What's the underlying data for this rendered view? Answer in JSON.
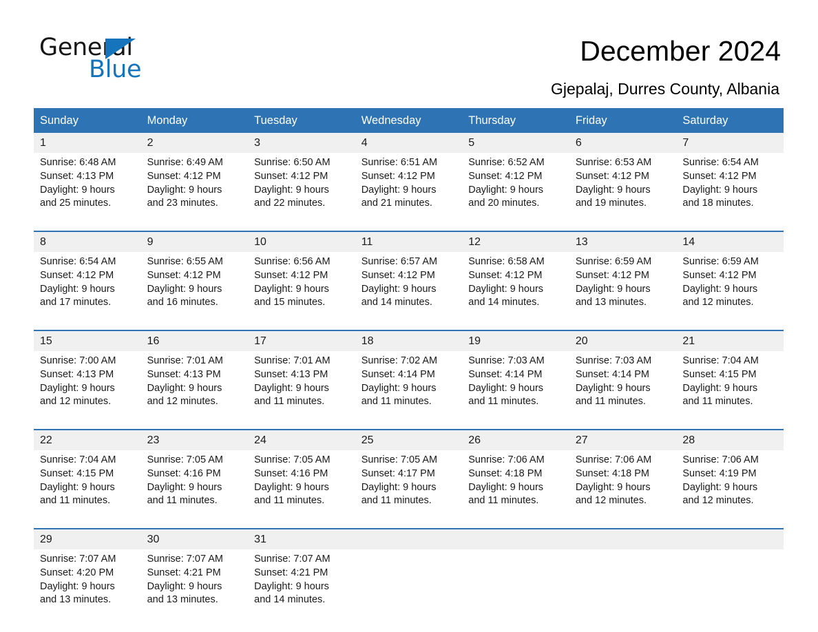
{
  "brand": {
    "name_part1": "General",
    "name_part2": "Blue",
    "triangle_color": "#1574bb"
  },
  "header": {
    "title": "December 2024",
    "subtitle": "Gjepalaj, Durres County, Albania"
  },
  "theme": {
    "accent": "#2e74b5",
    "daynum_bg": "#f0f0f0",
    "text": "#1a1a1a",
    "cell_bg": "#ffffff"
  },
  "calendar": {
    "weekday_headers": [
      "Sunday",
      "Monday",
      "Tuesday",
      "Wednesday",
      "Thursday",
      "Friday",
      "Saturday"
    ],
    "weeks": [
      [
        {
          "day": "1",
          "l1": "Sunrise: 6:48 AM",
          "l2": "Sunset: 4:13 PM",
          "l3": "Daylight: 9 hours",
          "l4": "and 25 minutes."
        },
        {
          "day": "2",
          "l1": "Sunrise: 6:49 AM",
          "l2": "Sunset: 4:12 PM",
          "l3": "Daylight: 9 hours",
          "l4": "and 23 minutes."
        },
        {
          "day": "3",
          "l1": "Sunrise: 6:50 AM",
          "l2": "Sunset: 4:12 PM",
          "l3": "Daylight: 9 hours",
          "l4": "and 22 minutes."
        },
        {
          "day": "4",
          "l1": "Sunrise: 6:51 AM",
          "l2": "Sunset: 4:12 PM",
          "l3": "Daylight: 9 hours",
          "l4": "and 21 minutes."
        },
        {
          "day": "5",
          "l1": "Sunrise: 6:52 AM",
          "l2": "Sunset: 4:12 PM",
          "l3": "Daylight: 9 hours",
          "l4": "and 20 minutes."
        },
        {
          "day": "6",
          "l1": "Sunrise: 6:53 AM",
          "l2": "Sunset: 4:12 PM",
          "l3": "Daylight: 9 hours",
          "l4": "and 19 minutes."
        },
        {
          "day": "7",
          "l1": "Sunrise: 6:54 AM",
          "l2": "Sunset: 4:12 PM",
          "l3": "Daylight: 9 hours",
          "l4": "and 18 minutes."
        }
      ],
      [
        {
          "day": "8",
          "l1": "Sunrise: 6:54 AM",
          "l2": "Sunset: 4:12 PM",
          "l3": "Daylight: 9 hours",
          "l4": "and 17 minutes."
        },
        {
          "day": "9",
          "l1": "Sunrise: 6:55 AM",
          "l2": "Sunset: 4:12 PM",
          "l3": "Daylight: 9 hours",
          "l4": "and 16 minutes."
        },
        {
          "day": "10",
          "l1": "Sunrise: 6:56 AM",
          "l2": "Sunset: 4:12 PM",
          "l3": "Daylight: 9 hours",
          "l4": "and 15 minutes."
        },
        {
          "day": "11",
          "l1": "Sunrise: 6:57 AM",
          "l2": "Sunset: 4:12 PM",
          "l3": "Daylight: 9 hours",
          "l4": "and 14 minutes."
        },
        {
          "day": "12",
          "l1": "Sunrise: 6:58 AM",
          "l2": "Sunset: 4:12 PM",
          "l3": "Daylight: 9 hours",
          "l4": "and 14 minutes."
        },
        {
          "day": "13",
          "l1": "Sunrise: 6:59 AM",
          "l2": "Sunset: 4:12 PM",
          "l3": "Daylight: 9 hours",
          "l4": "and 13 minutes."
        },
        {
          "day": "14",
          "l1": "Sunrise: 6:59 AM",
          "l2": "Sunset: 4:12 PM",
          "l3": "Daylight: 9 hours",
          "l4": "and 12 minutes."
        }
      ],
      [
        {
          "day": "15",
          "l1": "Sunrise: 7:00 AM",
          "l2": "Sunset: 4:13 PM",
          "l3": "Daylight: 9 hours",
          "l4": "and 12 minutes."
        },
        {
          "day": "16",
          "l1": "Sunrise: 7:01 AM",
          "l2": "Sunset: 4:13 PM",
          "l3": "Daylight: 9 hours",
          "l4": "and 12 minutes."
        },
        {
          "day": "17",
          "l1": "Sunrise: 7:01 AM",
          "l2": "Sunset: 4:13 PM",
          "l3": "Daylight: 9 hours",
          "l4": "and 11 minutes."
        },
        {
          "day": "18",
          "l1": "Sunrise: 7:02 AM",
          "l2": "Sunset: 4:14 PM",
          "l3": "Daylight: 9 hours",
          "l4": "and 11 minutes."
        },
        {
          "day": "19",
          "l1": "Sunrise: 7:03 AM",
          "l2": "Sunset: 4:14 PM",
          "l3": "Daylight: 9 hours",
          "l4": "and 11 minutes."
        },
        {
          "day": "20",
          "l1": "Sunrise: 7:03 AM",
          "l2": "Sunset: 4:14 PM",
          "l3": "Daylight: 9 hours",
          "l4": "and 11 minutes."
        },
        {
          "day": "21",
          "l1": "Sunrise: 7:04 AM",
          "l2": "Sunset: 4:15 PM",
          "l3": "Daylight: 9 hours",
          "l4": "and 11 minutes."
        }
      ],
      [
        {
          "day": "22",
          "l1": "Sunrise: 7:04 AM",
          "l2": "Sunset: 4:15 PM",
          "l3": "Daylight: 9 hours",
          "l4": "and 11 minutes."
        },
        {
          "day": "23",
          "l1": "Sunrise: 7:05 AM",
          "l2": "Sunset: 4:16 PM",
          "l3": "Daylight: 9 hours",
          "l4": "and 11 minutes."
        },
        {
          "day": "24",
          "l1": "Sunrise: 7:05 AM",
          "l2": "Sunset: 4:16 PM",
          "l3": "Daylight: 9 hours",
          "l4": "and 11 minutes."
        },
        {
          "day": "25",
          "l1": "Sunrise: 7:05 AM",
          "l2": "Sunset: 4:17 PM",
          "l3": "Daylight: 9 hours",
          "l4": "and 11 minutes."
        },
        {
          "day": "26",
          "l1": "Sunrise: 7:06 AM",
          "l2": "Sunset: 4:18 PM",
          "l3": "Daylight: 9 hours",
          "l4": "and 11 minutes."
        },
        {
          "day": "27",
          "l1": "Sunrise: 7:06 AM",
          "l2": "Sunset: 4:18 PM",
          "l3": "Daylight: 9 hours",
          "l4": "and 12 minutes."
        },
        {
          "day": "28",
          "l1": "Sunrise: 7:06 AM",
          "l2": "Sunset: 4:19 PM",
          "l3": "Daylight: 9 hours",
          "l4": "and 12 minutes."
        }
      ],
      [
        {
          "day": "29",
          "l1": "Sunrise: 7:07 AM",
          "l2": "Sunset: 4:20 PM",
          "l3": "Daylight: 9 hours",
          "l4": "and 13 minutes."
        },
        {
          "day": "30",
          "l1": "Sunrise: 7:07 AM",
          "l2": "Sunset: 4:21 PM",
          "l3": "Daylight: 9 hours",
          "l4": "and 13 minutes."
        },
        {
          "day": "31",
          "l1": "Sunrise: 7:07 AM",
          "l2": "Sunset: 4:21 PM",
          "l3": "Daylight: 9 hours",
          "l4": "and 14 minutes."
        },
        {
          "day": "",
          "l1": "",
          "l2": "",
          "l3": "",
          "l4": ""
        },
        {
          "day": "",
          "l1": "",
          "l2": "",
          "l3": "",
          "l4": ""
        },
        {
          "day": "",
          "l1": "",
          "l2": "",
          "l3": "",
          "l4": ""
        },
        {
          "day": "",
          "l1": "",
          "l2": "",
          "l3": "",
          "l4": ""
        }
      ]
    ]
  }
}
